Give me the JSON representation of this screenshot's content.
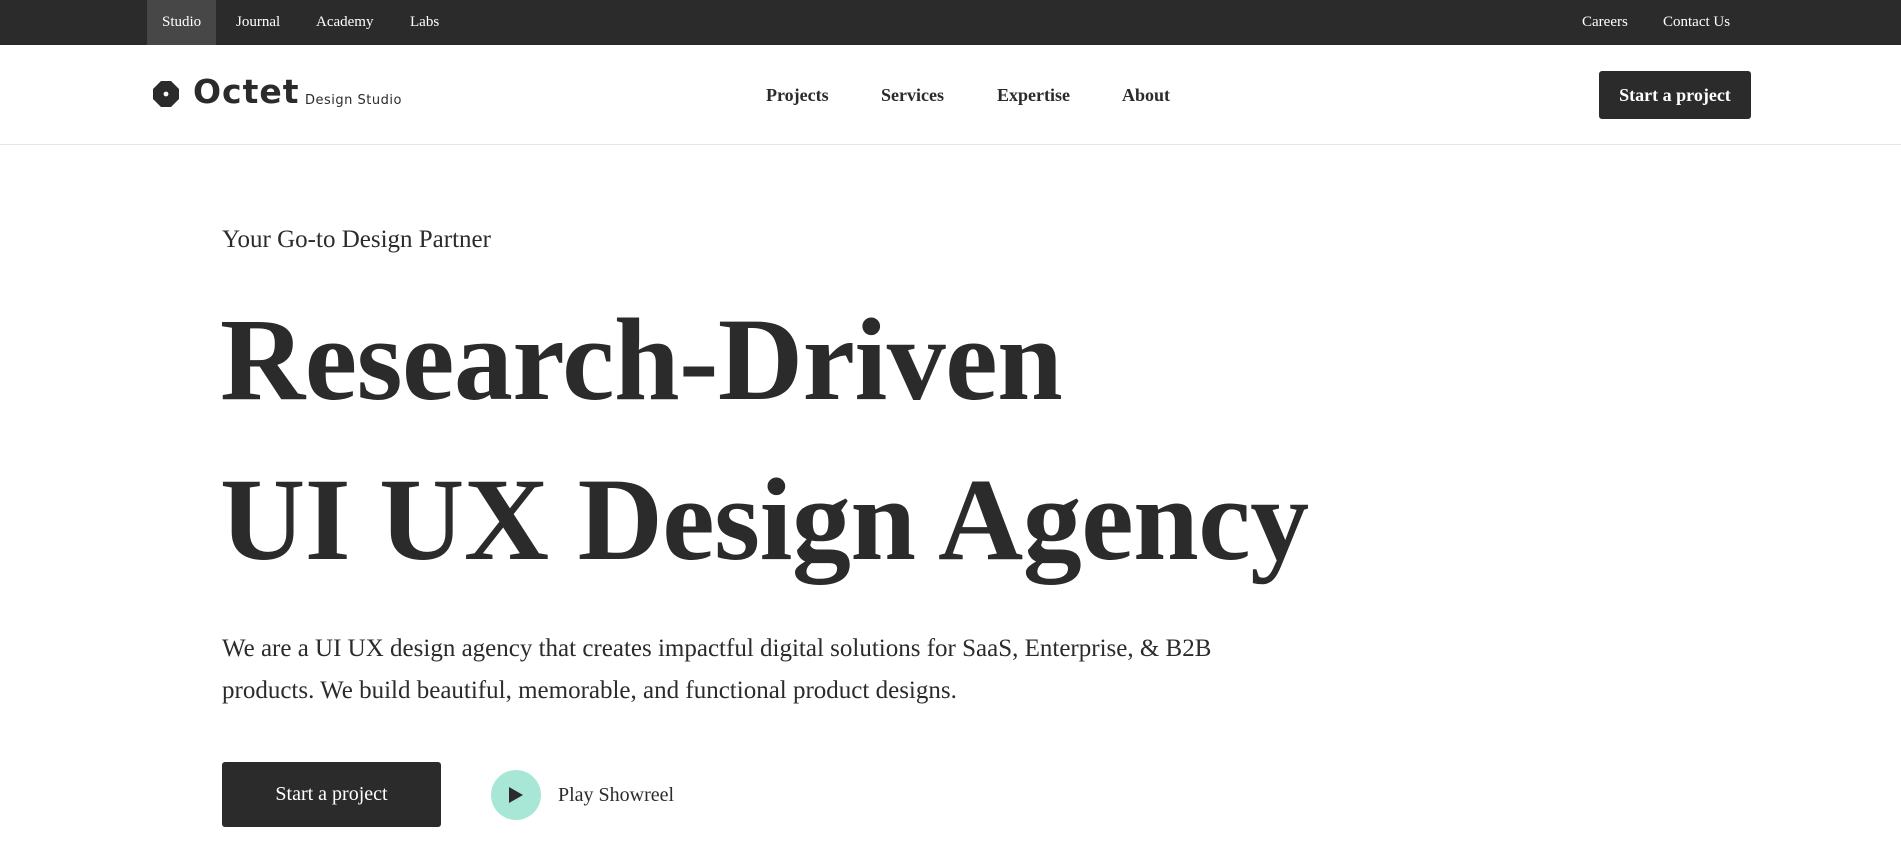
{
  "topbar": {
    "left_links": [
      "Studio",
      "Journal",
      "Academy",
      "Labs"
    ],
    "right_links": [
      "Careers",
      "Contact Us"
    ]
  },
  "header": {
    "logo_name": "Octet",
    "logo_tagline": "Design Studio",
    "nav": [
      "Projects",
      "Services",
      "Expertise",
      "About"
    ],
    "cta_label": "Start a project"
  },
  "hero": {
    "eyebrow": "Your Go-to Design Partner",
    "headline_line1": "Research-Driven",
    "headline_line2": "UI UX Design Agency",
    "description": "We are a UI UX design agency that creates impactful digital solutions for SaaS, Enterprise, & B2B products. We build beautiful, memorable, and functional product designs.",
    "cta_label": "Start a project",
    "play_label": "Play Showreel"
  },
  "colors": {
    "dark": "#2b2b2b",
    "topbar_active": "#474747",
    "play_accent": "#a8e6d6"
  },
  "icons": {
    "logo": "octagon-logo-icon",
    "play": "play-icon"
  }
}
